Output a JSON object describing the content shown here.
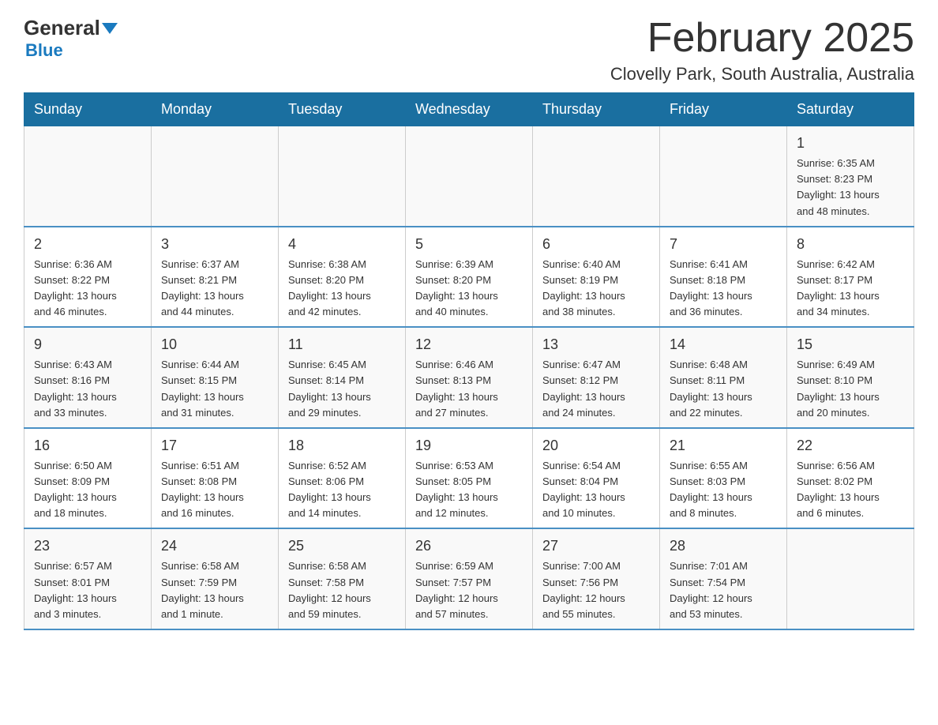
{
  "header": {
    "logo_line1": "General",
    "logo_line2": "Blue",
    "month_title": "February 2025",
    "location": "Clovelly Park, South Australia, Australia"
  },
  "weekdays": [
    "Sunday",
    "Monday",
    "Tuesday",
    "Wednesday",
    "Thursday",
    "Friday",
    "Saturday"
  ],
  "weeks": [
    [
      {
        "day": "",
        "info": ""
      },
      {
        "day": "",
        "info": ""
      },
      {
        "day": "",
        "info": ""
      },
      {
        "day": "",
        "info": ""
      },
      {
        "day": "",
        "info": ""
      },
      {
        "day": "",
        "info": ""
      },
      {
        "day": "1",
        "info": "Sunrise: 6:35 AM\nSunset: 8:23 PM\nDaylight: 13 hours\nand 48 minutes."
      }
    ],
    [
      {
        "day": "2",
        "info": "Sunrise: 6:36 AM\nSunset: 8:22 PM\nDaylight: 13 hours\nand 46 minutes."
      },
      {
        "day": "3",
        "info": "Sunrise: 6:37 AM\nSunset: 8:21 PM\nDaylight: 13 hours\nand 44 minutes."
      },
      {
        "day": "4",
        "info": "Sunrise: 6:38 AM\nSunset: 8:20 PM\nDaylight: 13 hours\nand 42 minutes."
      },
      {
        "day": "5",
        "info": "Sunrise: 6:39 AM\nSunset: 8:20 PM\nDaylight: 13 hours\nand 40 minutes."
      },
      {
        "day": "6",
        "info": "Sunrise: 6:40 AM\nSunset: 8:19 PM\nDaylight: 13 hours\nand 38 minutes."
      },
      {
        "day": "7",
        "info": "Sunrise: 6:41 AM\nSunset: 8:18 PM\nDaylight: 13 hours\nand 36 minutes."
      },
      {
        "day": "8",
        "info": "Sunrise: 6:42 AM\nSunset: 8:17 PM\nDaylight: 13 hours\nand 34 minutes."
      }
    ],
    [
      {
        "day": "9",
        "info": "Sunrise: 6:43 AM\nSunset: 8:16 PM\nDaylight: 13 hours\nand 33 minutes."
      },
      {
        "day": "10",
        "info": "Sunrise: 6:44 AM\nSunset: 8:15 PM\nDaylight: 13 hours\nand 31 minutes."
      },
      {
        "day": "11",
        "info": "Sunrise: 6:45 AM\nSunset: 8:14 PM\nDaylight: 13 hours\nand 29 minutes."
      },
      {
        "day": "12",
        "info": "Sunrise: 6:46 AM\nSunset: 8:13 PM\nDaylight: 13 hours\nand 27 minutes."
      },
      {
        "day": "13",
        "info": "Sunrise: 6:47 AM\nSunset: 8:12 PM\nDaylight: 13 hours\nand 24 minutes."
      },
      {
        "day": "14",
        "info": "Sunrise: 6:48 AM\nSunset: 8:11 PM\nDaylight: 13 hours\nand 22 minutes."
      },
      {
        "day": "15",
        "info": "Sunrise: 6:49 AM\nSunset: 8:10 PM\nDaylight: 13 hours\nand 20 minutes."
      }
    ],
    [
      {
        "day": "16",
        "info": "Sunrise: 6:50 AM\nSunset: 8:09 PM\nDaylight: 13 hours\nand 18 minutes."
      },
      {
        "day": "17",
        "info": "Sunrise: 6:51 AM\nSunset: 8:08 PM\nDaylight: 13 hours\nand 16 minutes."
      },
      {
        "day": "18",
        "info": "Sunrise: 6:52 AM\nSunset: 8:06 PM\nDaylight: 13 hours\nand 14 minutes."
      },
      {
        "day": "19",
        "info": "Sunrise: 6:53 AM\nSunset: 8:05 PM\nDaylight: 13 hours\nand 12 minutes."
      },
      {
        "day": "20",
        "info": "Sunrise: 6:54 AM\nSunset: 8:04 PM\nDaylight: 13 hours\nand 10 minutes."
      },
      {
        "day": "21",
        "info": "Sunrise: 6:55 AM\nSunset: 8:03 PM\nDaylight: 13 hours\nand 8 minutes."
      },
      {
        "day": "22",
        "info": "Sunrise: 6:56 AM\nSunset: 8:02 PM\nDaylight: 13 hours\nand 6 minutes."
      }
    ],
    [
      {
        "day": "23",
        "info": "Sunrise: 6:57 AM\nSunset: 8:01 PM\nDaylight: 13 hours\nand 3 minutes."
      },
      {
        "day": "24",
        "info": "Sunrise: 6:58 AM\nSunset: 7:59 PM\nDaylight: 13 hours\nand 1 minute."
      },
      {
        "day": "25",
        "info": "Sunrise: 6:58 AM\nSunset: 7:58 PM\nDaylight: 12 hours\nand 59 minutes."
      },
      {
        "day": "26",
        "info": "Sunrise: 6:59 AM\nSunset: 7:57 PM\nDaylight: 12 hours\nand 57 minutes."
      },
      {
        "day": "27",
        "info": "Sunrise: 7:00 AM\nSunset: 7:56 PM\nDaylight: 12 hours\nand 55 minutes."
      },
      {
        "day": "28",
        "info": "Sunrise: 7:01 AM\nSunset: 7:54 PM\nDaylight: 12 hours\nand 53 minutes."
      },
      {
        "day": "",
        "info": ""
      }
    ]
  ]
}
